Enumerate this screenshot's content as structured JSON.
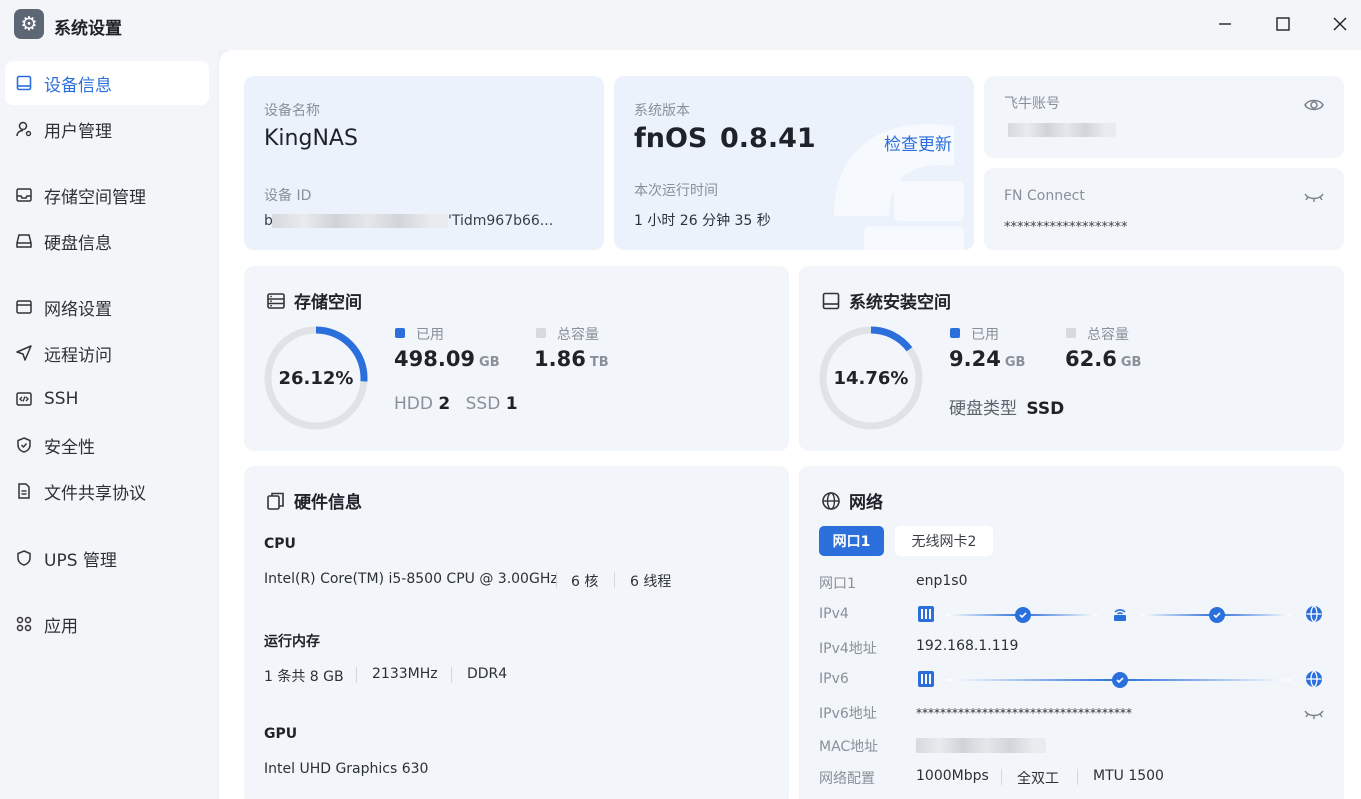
{
  "app": {
    "title": "系统设置"
  },
  "sidebar": {
    "items": [
      {
        "label": "设备信息"
      },
      {
        "label": "用户管理"
      },
      {
        "label": "存储空间管理"
      },
      {
        "label": "硬盘信息"
      },
      {
        "label": "网络设置"
      },
      {
        "label": "远程访问"
      },
      {
        "label": "SSH"
      },
      {
        "label": "安全性"
      },
      {
        "label": "文件共享协议"
      },
      {
        "label": "UPS 管理"
      },
      {
        "label": "应用"
      }
    ]
  },
  "device": {
    "name_label": "设备名称",
    "name": "KingNAS",
    "id_label": "设备 ID",
    "id_prefix": "b",
    "id_suffix": "'Tidm967b66..."
  },
  "system": {
    "version_label": "系统版本",
    "os": "fnOS",
    "version": "0.8.41",
    "check_update": "检查更新",
    "uptime_label": "本次运行时间",
    "uptime": "1 小时 26 分钟 35 秒"
  },
  "account": {
    "label": "飞牛账号",
    "connect_label": "FN Connect",
    "connect_value": "*******************"
  },
  "storage": {
    "title": "存储空间",
    "percent": "26.12%",
    "percent_value": 26.12,
    "used_label": "已用",
    "used": "498.09",
    "used_unit": "GB",
    "total_label": "总容量",
    "total": "1.86",
    "total_unit": "TB",
    "hdd_label": "HDD",
    "hdd": "2",
    "ssd_label": "SSD",
    "ssd": "1"
  },
  "sys_storage": {
    "title": "系统安装空间",
    "percent": "14.76%",
    "percent_value": 14.76,
    "used_label": "已用",
    "used": "9.24",
    "used_unit": "GB",
    "total_label": "总容量",
    "total": "62.6",
    "total_unit": "GB",
    "disk_type_label": "硬盘类型",
    "disk_type": "SSD"
  },
  "hardware": {
    "title": "硬件信息",
    "cpu_label": "CPU",
    "cpu_model": "Intel(R) Core(TM) i5-8500 CPU @ 3.00GHz",
    "cpu_cores": "6 核",
    "cpu_threads": "6 线程",
    "mem_label": "运行内存",
    "mem_size": "1 条共 8 GB",
    "mem_speed": "2133MHz",
    "mem_type": "DDR4",
    "gpu_label": "GPU",
    "gpu_model": "Intel UHD Graphics 630"
  },
  "network": {
    "title": "网络",
    "tabs": [
      {
        "label": "网口1"
      },
      {
        "label": "无线网卡2"
      }
    ],
    "port_label": "网口1",
    "port_value": "enp1s0",
    "ipv4_label": "IPv4",
    "ipv4_addr_label": "IPv4地址",
    "ipv4_addr": "192.168.1.119",
    "ipv6_label": "IPv6",
    "ipv6_addr_label": "IPv6地址",
    "ipv6_addr": "************************************",
    "mac_label": "MAC地址",
    "config_label": "网络配置",
    "speed": "1000Mbps",
    "duplex": "全双工",
    "mtu": "MTU 1500"
  },
  "colors": {
    "accent": "#2a6fdb",
    "ring_track": "#dfe3e8",
    "total_legend": "#d6d9de"
  }
}
